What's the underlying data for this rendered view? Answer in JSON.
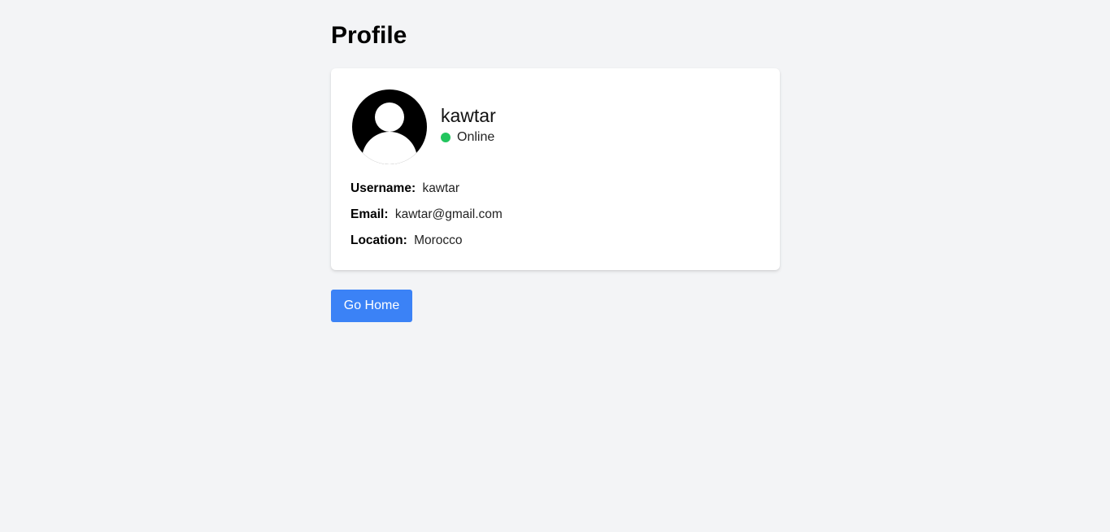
{
  "page": {
    "title": "Profile"
  },
  "profile": {
    "display_name": "kawtar",
    "status": "Online",
    "avatar_icon": "user-silhouette-icon",
    "status_color": "#22c55e"
  },
  "details": [
    {
      "label": "Username:",
      "value": "kawtar"
    },
    {
      "label": "Email:",
      "value": "kawtar@gmail.com"
    },
    {
      "label": "Location:",
      "value": "Morocco"
    }
  ],
  "actions": {
    "home_label": "Go Home",
    "home_color": "#3b82f6"
  }
}
